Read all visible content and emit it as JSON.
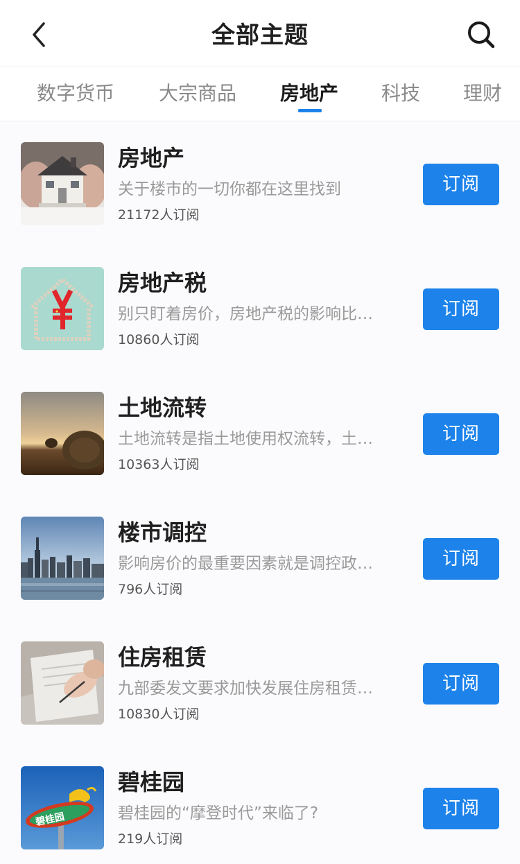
{
  "header": {
    "title": "全部主题",
    "back_icon": "chevron-left-icon",
    "search_icon": "search-icon"
  },
  "tabs": [
    {
      "label": "数字货币",
      "active": false
    },
    {
      "label": "大宗商品",
      "active": false
    },
    {
      "label": "房地产",
      "active": true
    },
    {
      "label": "科技",
      "active": false
    },
    {
      "label": "理财",
      "active": false
    }
  ],
  "accent_color": "#1d83ea",
  "items": [
    {
      "title": "房地产",
      "desc": "关于楼市的一切你都在这里找到",
      "count": "21172人订阅",
      "button": "订阅"
    },
    {
      "title": "房地产税",
      "desc": "别只盯着房价，房地产税的影响比…",
      "count": "10860人订阅",
      "button": "订阅"
    },
    {
      "title": "土地流转",
      "desc": "土地流转是指土地使用权流转，土…",
      "count": "10363人订阅",
      "button": "订阅"
    },
    {
      "title": "楼市调控",
      "desc": "影响房价的最重要因素就是调控政…",
      "count": "796人订阅",
      "button": "订阅"
    },
    {
      "title": "住房租赁",
      "desc": "九部委发文要求加快发展住房租赁…",
      "count": "10830人订阅",
      "button": "订阅"
    },
    {
      "title": "碧桂园",
      "desc": "碧桂园的“摩登时代”来临了?",
      "count": "219人订阅",
      "button": "订阅",
      "logo_text": "碧桂园"
    }
  ]
}
